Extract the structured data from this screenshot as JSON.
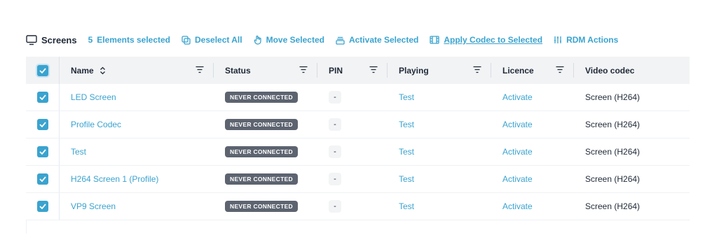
{
  "toolbar": {
    "title": "Screens",
    "selected_count": "5",
    "selected_label": "Elements selected",
    "actions": [
      {
        "label": "Deselect All",
        "icon": "deselect-icon"
      },
      {
        "label": "Move Selected",
        "icon": "move-icon"
      },
      {
        "label": "Activate Selected",
        "icon": "activate-icon"
      },
      {
        "label": "Apply Codec to Selected",
        "icon": "film-icon"
      },
      {
        "label": "RDM Actions",
        "icon": "sliders-icon"
      }
    ]
  },
  "table": {
    "columns": [
      "Name",
      "Status",
      "PIN",
      "Playing",
      "Licence",
      "Video codec"
    ],
    "rows": [
      {
        "name": "LED Screen",
        "status": "NEVER CONNECTED",
        "pin": "-",
        "playing": "Test",
        "licence": "Activate",
        "codec": "Screen (H264)"
      },
      {
        "name": "Profile Codec",
        "status": "NEVER CONNECTED",
        "pin": "-",
        "playing": "Test",
        "licence": "Activate",
        "codec": "Screen (H264)"
      },
      {
        "name": "Test",
        "status": "NEVER CONNECTED",
        "pin": "-",
        "playing": "Test",
        "licence": "Activate",
        "codec": "Screen (H264)"
      },
      {
        "name": "H264 Screen 1 (Profile)",
        "status": "NEVER CONNECTED",
        "pin": "-",
        "playing": "Test",
        "licence": "Activate",
        "codec": "Screen (H264)"
      },
      {
        "name": "VP9 Screen",
        "status": "NEVER CONNECTED",
        "pin": "-",
        "playing": "Test",
        "licence": "Activate",
        "codec": "Screen (H264)"
      }
    ]
  },
  "colors": {
    "accent": "#3aa3cf",
    "badge": "#5d6470",
    "header_bg": "#f2f3f5"
  }
}
